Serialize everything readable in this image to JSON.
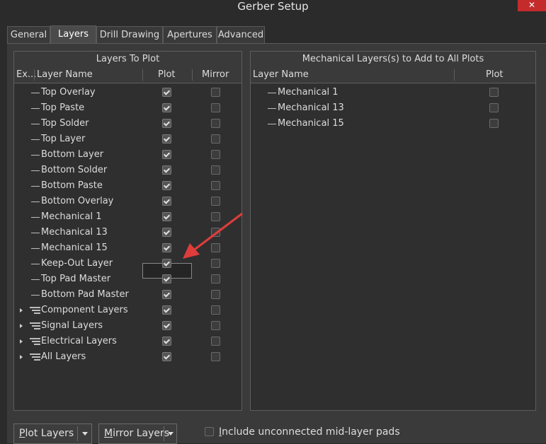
{
  "window": {
    "title": "Gerber Setup",
    "close_glyph": "✕"
  },
  "tabs": [
    {
      "label": "General"
    },
    {
      "label": "Layers"
    },
    {
      "label": "Drill Drawing"
    },
    {
      "label": "Apertures"
    },
    {
      "label": "Advanced"
    }
  ],
  "left_panel": {
    "title": "Layers To Plot",
    "columns": {
      "ex": "Ex...",
      "name": "Layer Name",
      "plot": "Plot",
      "mirror": "Mirror"
    },
    "rows": [
      {
        "name": "Top Overlay",
        "plot": true,
        "mirror": false,
        "group": false
      },
      {
        "name": "Top Paste",
        "plot": true,
        "mirror": false,
        "group": false
      },
      {
        "name": "Top Solder",
        "plot": true,
        "mirror": false,
        "group": false
      },
      {
        "name": "Top Layer",
        "plot": true,
        "mirror": false,
        "group": false
      },
      {
        "name": "Bottom Layer",
        "plot": true,
        "mirror": false,
        "group": false
      },
      {
        "name": "Bottom Solder",
        "plot": true,
        "mirror": false,
        "group": false
      },
      {
        "name": "Bottom Paste",
        "plot": true,
        "mirror": false,
        "group": false
      },
      {
        "name": "Bottom Overlay",
        "plot": true,
        "mirror": false,
        "group": false
      },
      {
        "name": "Mechanical 1",
        "plot": true,
        "mirror": false,
        "group": false
      },
      {
        "name": "Mechanical 13",
        "plot": true,
        "mirror": false,
        "group": false
      },
      {
        "name": "Mechanical 15",
        "plot": true,
        "mirror": false,
        "group": false
      },
      {
        "name": "Keep-Out Layer",
        "plot": true,
        "mirror": false,
        "group": false
      },
      {
        "name": "Top Pad Master",
        "plot": true,
        "mirror": false,
        "group": false
      },
      {
        "name": "Bottom Pad Master",
        "plot": true,
        "mirror": false,
        "group": false
      },
      {
        "name": "Component Layers",
        "plot": true,
        "mirror": false,
        "group": true
      },
      {
        "name": "Signal Layers",
        "plot": true,
        "mirror": false,
        "group": true
      },
      {
        "name": "Electrical Layers",
        "plot": true,
        "mirror": false,
        "group": true
      },
      {
        "name": "All Layers",
        "plot": true,
        "mirror": false,
        "group": true
      }
    ]
  },
  "right_panel": {
    "title": "Mechanical Layers(s) to Add to All Plots",
    "columns": {
      "name": "Layer Name",
      "plot": "Plot"
    },
    "rows": [
      {
        "name": "Mechanical 1",
        "plot": false
      },
      {
        "name": "Mechanical 13",
        "plot": false
      },
      {
        "name": "Mechanical 15",
        "plot": false
      }
    ]
  },
  "bottom": {
    "plot_layers": {
      "prefix": "P",
      "rest": "lot Layers"
    },
    "mirror_layers": {
      "prefix": "M",
      "rest": "irror Layers"
    },
    "include_unconnected": {
      "prefix": "I",
      "rest": "nclude unconnected mid-layer pads",
      "checked": false
    }
  },
  "colors": {
    "accent": "#e03c3c",
    "close": "#c42b2b"
  }
}
